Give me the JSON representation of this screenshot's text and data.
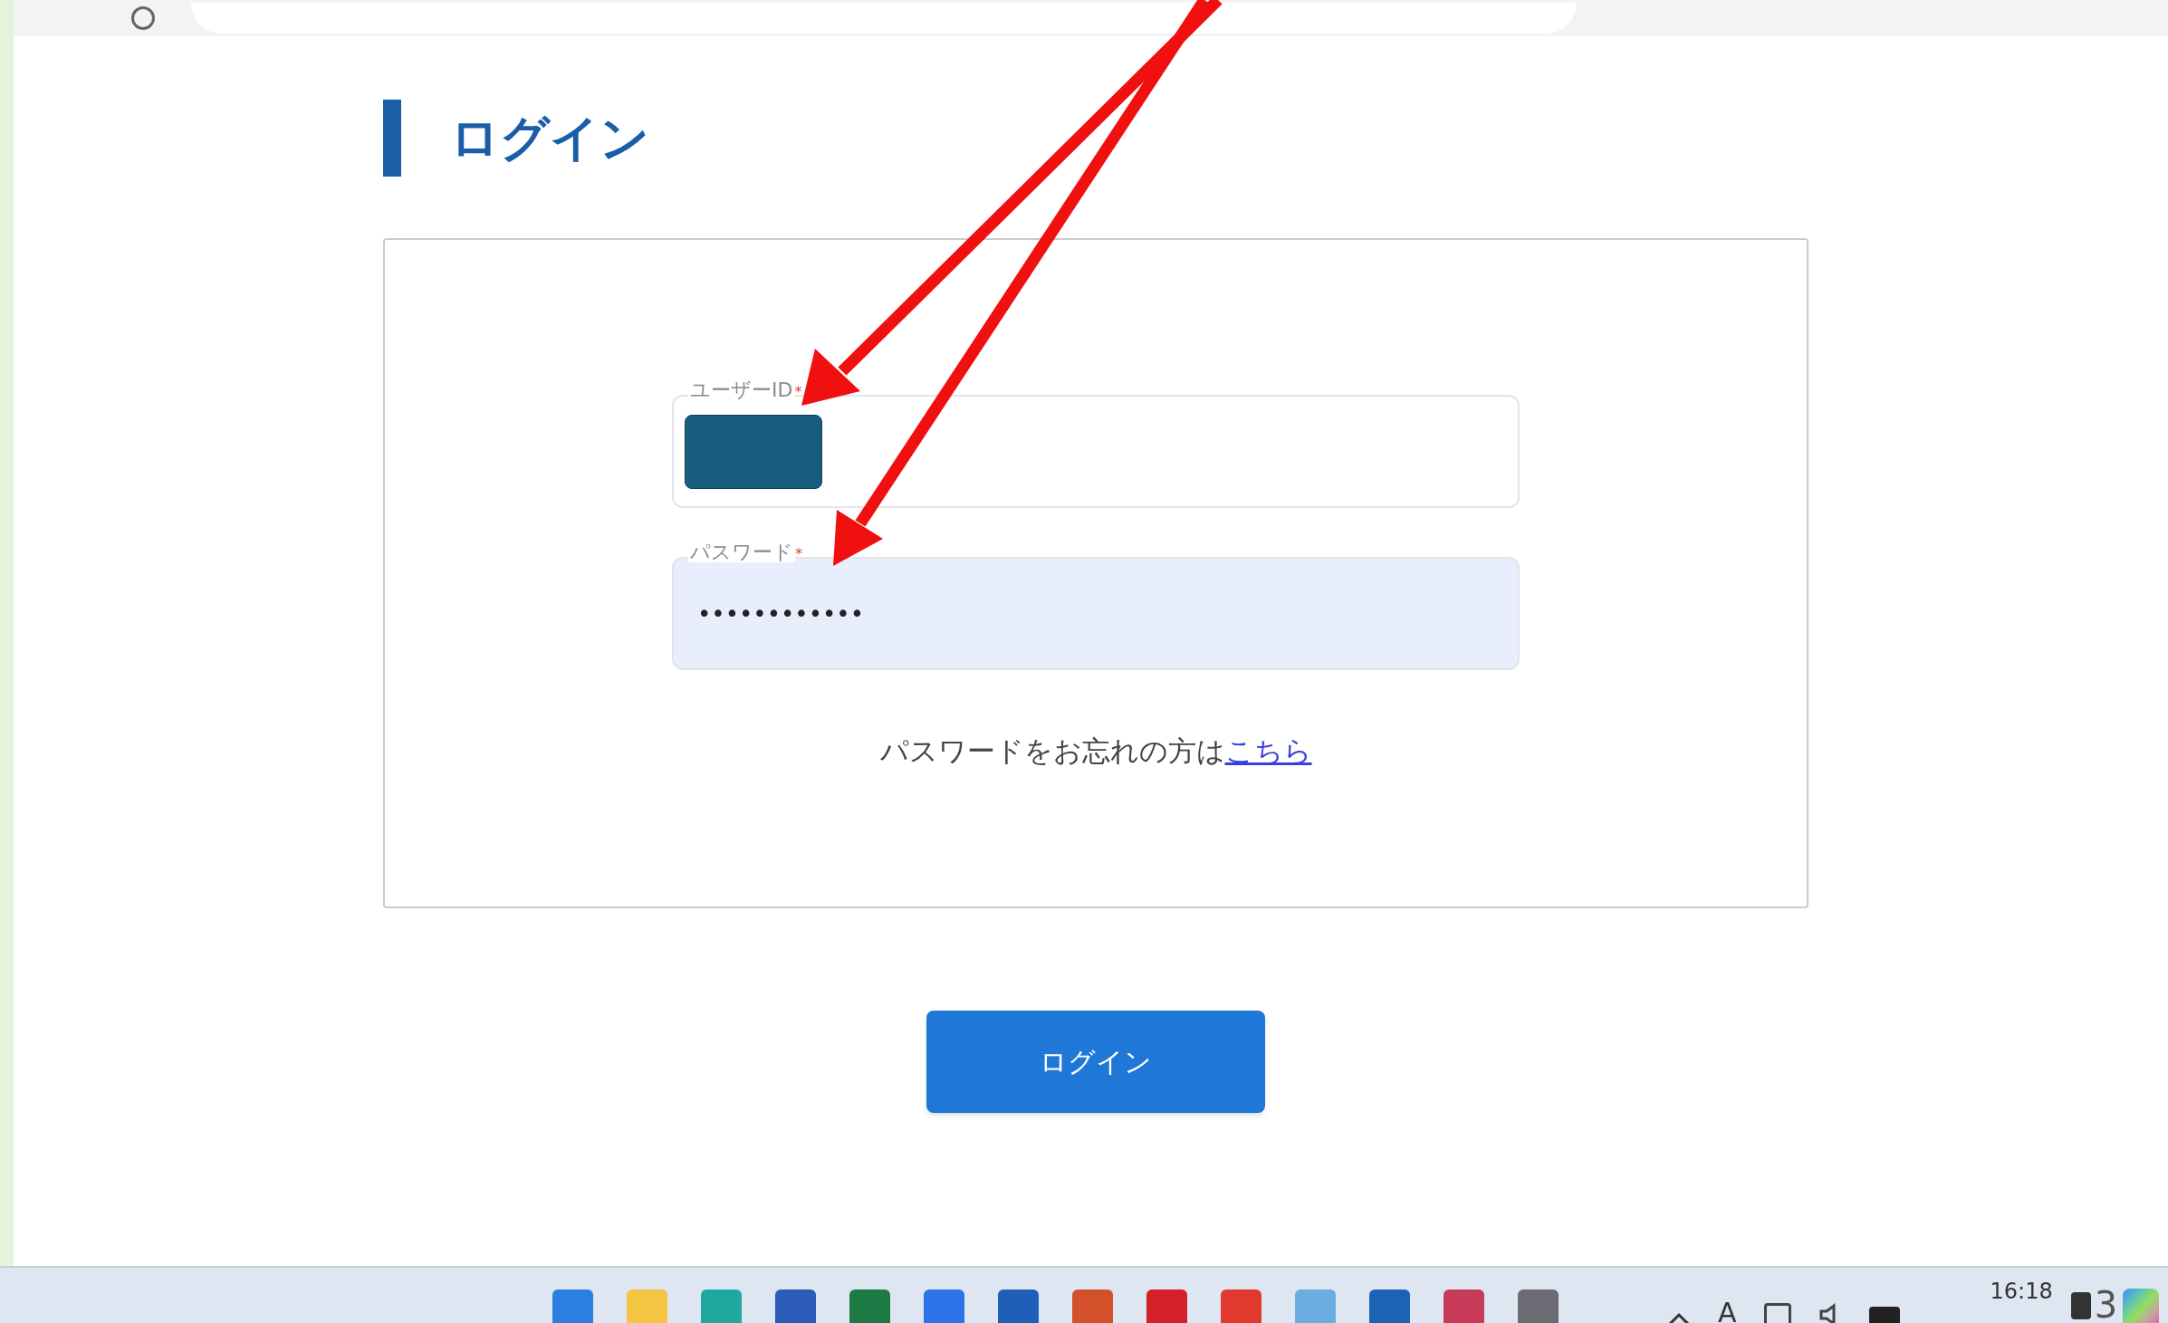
{
  "heading": "ログイン",
  "fields": [
    {
      "label": "ユーザーID",
      "required_mark": "*",
      "redacted": true,
      "autofilled": false
    },
    {
      "label": "パスワード",
      "required_mark": "*",
      "value": "••••••••••••",
      "autofilled": true
    }
  ],
  "forgot": {
    "text": "パスワードをお忘れの方は",
    "link": "こちら"
  },
  "button": "ログイン",
  "taskbar": {
    "ime": "A",
    "time": "16:18",
    "badge": "3"
  }
}
